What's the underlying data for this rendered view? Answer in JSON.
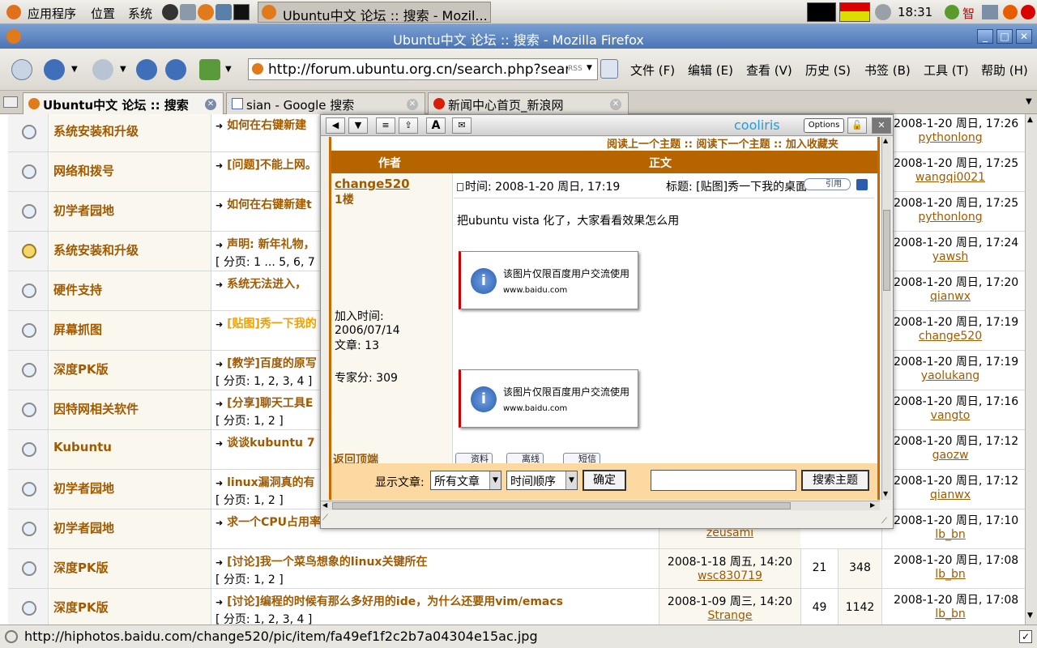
{
  "panel": {
    "menus": [
      "应用程序",
      "位置",
      "系统"
    ],
    "clock": "18:31",
    "ime": "智"
  },
  "window": {
    "title": "Ubuntu中文 论坛 :: 搜索 - Mozilla Firefox",
    "taskbar_label": "Ubuntu中文 论坛 :: 搜索 - Mozil..."
  },
  "nav": {
    "url": "http://forum.ubuntu.org.cn/search.php?search_i",
    "rss": "RSS"
  },
  "menubar": [
    "文件 (F)",
    "编辑 (E)",
    "查看 (V)",
    "历史 (S)",
    "书签 (B)",
    "工具 (T)",
    "帮助 (H)"
  ],
  "tabs": [
    "Ubuntu中文 论坛 :: 搜索",
    "sian - Google 搜索",
    "新闻中心首页_新浪网"
  ],
  "rows": [
    {
      "forum": "系统安装和升级",
      "topic": "如何在右键新建",
      "pages": "",
      "last_time": "2008-1-20 周日, 17:26",
      "last_user": "pythonlong",
      "icon": "normal"
    },
    {
      "forum": "网络和拨号",
      "topic": "[问题]不能上网。",
      "pages": "",
      "last_time": "2008-1-20 周日, 17:25",
      "last_user": "wangqi0021",
      "icon": "normal"
    },
    {
      "forum": "初学者园地",
      "topic": "如何在右键新建t",
      "pages": "",
      "last_time": "2008-1-20 周日, 17:25",
      "last_user": "pythonlong",
      "icon": "normal"
    },
    {
      "forum": "系统安装和升级",
      "topic": "声明: 新年礼物，",
      "pages": "[ 分页: 1 ... 5, 6, 7",
      "last_time": "2008-1-20 周日, 17:24",
      "last_user": "yawsh",
      "icon": "warn"
    },
    {
      "forum": "硬件支持",
      "topic": "系统无法进入，",
      "pages": "",
      "last_time": "2008-1-20 周日, 17:20",
      "last_user": "qianwx",
      "icon": "normal"
    },
    {
      "forum": "屏幕抓图",
      "topic": "[贴图]秀一下我的",
      "pages": "",
      "last_time": "2008-1-20 周日, 17:19",
      "last_user": "change520",
      "icon": "normal",
      "hl": true
    },
    {
      "forum": "深度PK版",
      "topic": "[教学]百度的原写",
      "pages": "[ 分页: 1, 2, 3, 4 ]",
      "last_time": "2008-1-20 周日, 17:19",
      "last_user": "yaolukang",
      "icon": "normal"
    },
    {
      "forum": "因特网相关软件",
      "topic": "[分享]聊天工具E",
      "pages": "[ 分页: 1, 2 ]",
      "last_time": "2008-1-20 周日, 17:16",
      "last_user": "vangto",
      "icon": "normal"
    },
    {
      "forum": "Kubuntu",
      "topic": "谈谈kubuntu 7",
      "pages": "",
      "last_time": "2008-1-20 周日, 17:12",
      "last_user": "gaozw",
      "icon": "normal"
    },
    {
      "forum": "初学者园地",
      "topic": "linux漏洞真的有",
      "pages": "[ 分页: 1, 2 ]",
      "last_time": "2008-1-20 周日, 17:12",
      "last_user": "qianwx",
      "icon": "normal"
    },
    {
      "forum": "初学者园地",
      "topic": "求一个CPU占用率",
      "pages": "",
      "started_user": "zeusami",
      "last_time": "2008-1-20 周日, 17:10",
      "last_user": "lb_bn",
      "icon": "normal"
    },
    {
      "forum": "深度PK版",
      "topic": "[讨论]我一个菜鸟想象的linux关键所在",
      "pages": "[ 分页: 1, 2 ]",
      "started_time": "2008-1-18 周五, 14:20",
      "started_user": "wsc830719",
      "replies": "21",
      "views": "348",
      "last_time": "2008-1-20 周日, 17:08",
      "last_user": "lb_bn",
      "icon": "normal"
    },
    {
      "forum": "深度PK版",
      "topic": "[讨论]编程的时候有那么多好用的ide，为什么还要用vim/emacs",
      "pages": "[ 分页: 1, 2, 3, 4 ]",
      "started_time": "2008-1-09 周三, 14:20",
      "started_user": "Strange",
      "replies": "49",
      "views": "1142",
      "last_time": "2008-1-20 周日, 17:08",
      "last_user": "lb_bn",
      "icon": "normal"
    }
  ],
  "cooliris": {
    "brand": "cooliris",
    "options": "Options",
    "top_links": "阅读上一个主题 :: 阅读下一个主题 :: 加入收藏夹",
    "col_author": "作者",
    "col_body": "正文",
    "author": "change520",
    "floor": "1楼",
    "joined_label": "加入时间:",
    "joined": "2006/07/14",
    "posts": "文章: 13",
    "score": "专家分: 309",
    "post_time": "时间: 2008-1-20 周日, 17:19",
    "post_title": "标题: [贴图]秀一下我的桌面",
    "quote": "引用",
    "body": "把ubuntu vista 化了，大家看看效果怎么用",
    "img_text": "该图片仅限百度用户交流使用",
    "img_site": "www.baidu.com",
    "back_top": "返回顶端",
    "btn_profile": "资料",
    "btn_offline": "离线",
    "btn_pm": "短信",
    "show_label": "显示文章:",
    "sel_all": "所有文章",
    "sel_order": "时间顺序",
    "ok": "确定",
    "search_btn": "搜索主题"
  },
  "status": {
    "text": "http://hiphotos.baidu.com/change520/pic/item/fa49ef1f2c2b7a04304e15ac.jpg"
  }
}
